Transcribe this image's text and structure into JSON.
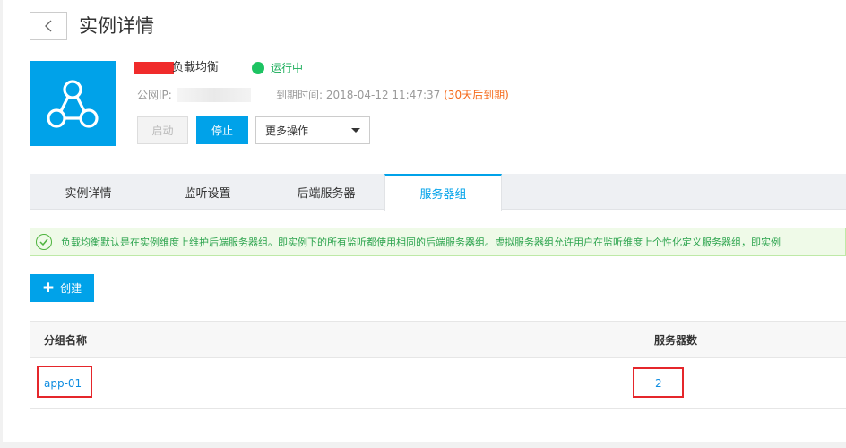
{
  "header": {
    "title": "实例详情"
  },
  "instance": {
    "name": "负载均衡",
    "status": "运行中",
    "ip_label": "公网IP:",
    "expire_label": "到期时间: 2018-04-12 11:47:37 ",
    "expire_warning": "(30天后到期)"
  },
  "actions": {
    "start": "启动",
    "stop": "停止",
    "more": "更多操作"
  },
  "tabs": [
    {
      "label": "实例详情"
    },
    {
      "label": "监听设置"
    },
    {
      "label": "后端服务器"
    },
    {
      "label": "服务器组"
    }
  ],
  "notice": {
    "text": "负载均衡默认是在实例维度上维护后端服务器组。即实例下的所有监听都使用相同的后端服务器组。虚拟服务器组允许用户在监听维度上个性化定义服务器组，即实例"
  },
  "create_button": "创建",
  "table": {
    "columns": [
      "分组名称",
      "服务器数"
    ],
    "rows": [
      {
        "group_name": "app-01",
        "server_count": "2"
      }
    ]
  },
  "colors": {
    "accent": "#00a2e9",
    "running": "#1dc362",
    "warning": "#f56b1c",
    "highlight": "#e5262b"
  }
}
